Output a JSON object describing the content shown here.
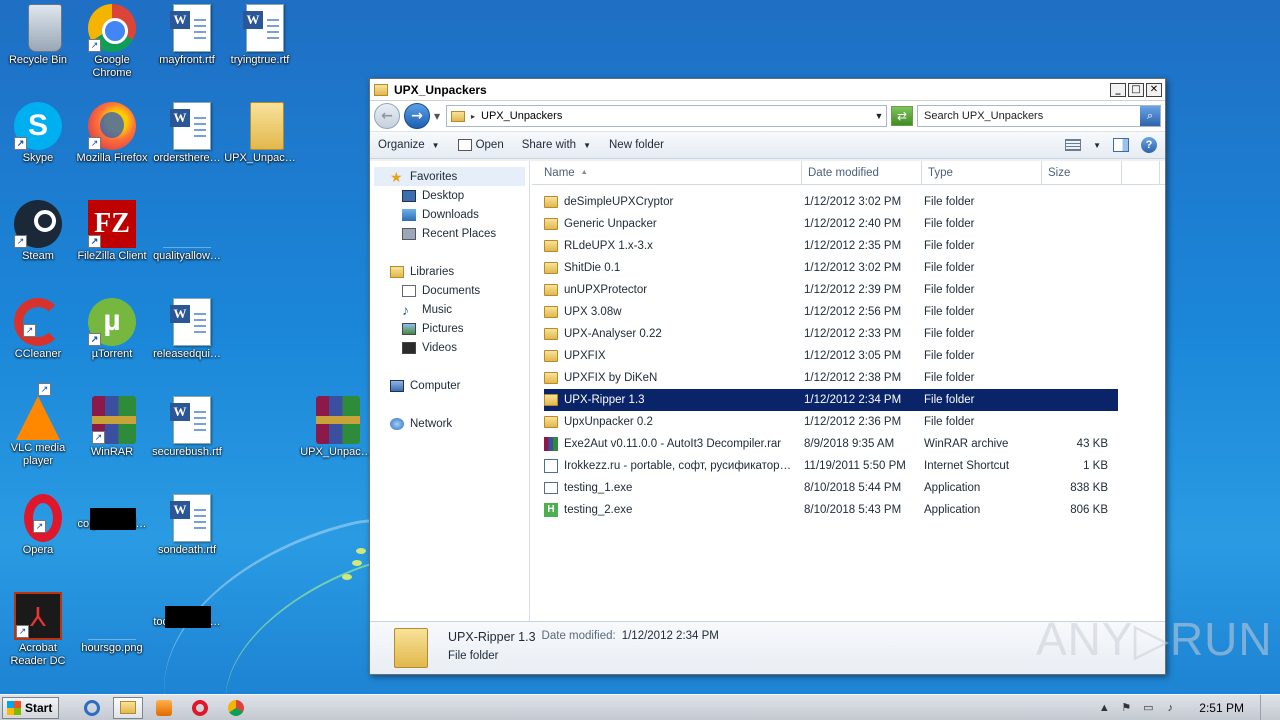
{
  "desktop": {
    "icons": [
      {
        "label": "Recycle Bin",
        "icon": "recycle-bin-icon"
      },
      {
        "label": "Google Chrome",
        "icon": "chrome-icon"
      },
      {
        "label": "mayfront.rtf",
        "icon": "word-document-icon"
      },
      {
        "label": "tryingtrue.rtf",
        "icon": "word-document-icon"
      },
      {
        "label": "Skype",
        "icon": "skype-icon"
      },
      {
        "label": "Mozilla Firefox",
        "icon": "firefox-icon"
      },
      {
        "label": "ordersthere…",
        "icon": "word-document-icon"
      },
      {
        "label": "UPX_Unpac…",
        "icon": "folder-icon"
      },
      {
        "label": "Steam",
        "icon": "steam-icon"
      },
      {
        "label": "FileZilla Client",
        "icon": "filezilla-icon"
      },
      {
        "label": "qualityallow…",
        "icon": "blank-file-icon"
      },
      {
        "label": "CCleaner",
        "icon": "ccleaner-icon"
      },
      {
        "label": "µTorrent",
        "icon": "utorrent-icon"
      },
      {
        "label": "releasedqui…",
        "icon": "word-document-icon"
      },
      {
        "label": "VLC media player",
        "icon": "vlc-icon"
      },
      {
        "label": "WinRAR",
        "icon": "winrar-icon"
      },
      {
        "label": "securebush.rtf",
        "icon": "word-document-icon"
      },
      {
        "label": "UPX_Unpac…",
        "icon": "winrar-archive-icon"
      },
      {
        "label": "Opera",
        "icon": "opera-icon"
      },
      {
        "label": "corporationf…",
        "icon": "black-thumbnail-icon"
      },
      {
        "label": "sondeath.rtf",
        "icon": "word-document-icon"
      },
      {
        "label": "Acrobat Reader DC",
        "icon": "acrobat-icon"
      },
      {
        "label": "hoursgo.png",
        "icon": "blank-image-icon"
      },
      {
        "label": "tocertificate…",
        "icon": "black-thumbnail-icon"
      }
    ]
  },
  "window": {
    "title": "UPX_Unpackers",
    "controls": {
      "minimize": "_",
      "maximize": "□",
      "close": "✕"
    },
    "address": {
      "path": "UPX_Unpackers"
    },
    "search": {
      "placeholder": "Search UPX_Unpackers"
    },
    "commands": {
      "organize": "Organize",
      "open": "Open",
      "share_with": "Share with",
      "new_folder": "New folder"
    },
    "nav": {
      "favorites": "Favorites",
      "desktop": "Desktop",
      "downloads": "Downloads",
      "recent_places": "Recent Places",
      "libraries": "Libraries",
      "documents": "Documents",
      "music": "Music",
      "pictures": "Pictures",
      "videos": "Videos",
      "computer": "Computer",
      "network": "Network"
    },
    "columns": {
      "name": "Name",
      "date": "Date modified",
      "type": "Type",
      "size": "Size"
    },
    "files": [
      {
        "name": "deSimpleUPXCryptor",
        "date": "1/12/2012 3:02 PM",
        "type": "File folder",
        "size": "",
        "icon": "folder-icon"
      },
      {
        "name": "Generic Unpacker",
        "date": "1/12/2012 2:40 PM",
        "type": "File folder",
        "size": "",
        "icon": "folder-icon"
      },
      {
        "name": "RLdeUPX 1.x-3.x",
        "date": "1/12/2012 2:35 PM",
        "type": "File folder",
        "size": "",
        "icon": "folder-icon"
      },
      {
        "name": "ShitDie 0.1",
        "date": "1/12/2012 3:02 PM",
        "type": "File folder",
        "size": "",
        "icon": "folder-icon"
      },
      {
        "name": "unUPXProtector",
        "date": "1/12/2012 2:39 PM",
        "type": "File folder",
        "size": "",
        "icon": "folder-icon"
      },
      {
        "name": "UPX 3.08w",
        "date": "1/12/2012 2:56 PM",
        "type": "File folder",
        "size": "",
        "icon": "folder-icon"
      },
      {
        "name": "UPX-Analyser 0.22",
        "date": "1/12/2012 2:33 PM",
        "type": "File folder",
        "size": "",
        "icon": "folder-icon"
      },
      {
        "name": "UPXFIX",
        "date": "1/12/2012 3:05 PM",
        "type": "File folder",
        "size": "",
        "icon": "folder-icon"
      },
      {
        "name": "UPXFIX by DiKeN",
        "date": "1/12/2012 2:38 PM",
        "type": "File folder",
        "size": "",
        "icon": "folder-icon"
      },
      {
        "name": "UPX-Ripper 1.3",
        "date": "1/12/2012 2:34 PM",
        "type": "File folder",
        "size": "",
        "icon": "folder-icon",
        "selected": true
      },
      {
        "name": "UpxUnpacker 0.2",
        "date": "1/12/2012 2:36 PM",
        "type": "File folder",
        "size": "",
        "icon": "folder-icon"
      },
      {
        "name": "Exe2Aut v0.11.0.0 - AutoIt3 Decompiler.rar",
        "date": "8/9/2018 9:35 AM",
        "type": "WinRAR archive",
        "size": "43 KB",
        "icon": "winrar-archive-icon"
      },
      {
        "name": "Irokkezz.ru - portable, софт, русификатор…",
        "date": "11/19/2011 5:50 PM",
        "type": "Internet Shortcut",
        "size": "1 KB",
        "icon": "internet-shortcut-icon"
      },
      {
        "name": "testing_1.exe",
        "date": "8/10/2018 5:44 PM",
        "type": "Application",
        "size": "838 KB",
        "icon": "application-icon"
      },
      {
        "name": "testing_2.exe",
        "date": "8/10/2018 5:43 PM",
        "type": "Application",
        "size": "806 KB",
        "icon": "h-application-icon"
      }
    ],
    "details": {
      "name": "UPX-Ripper 1.3",
      "date_label": "Date modified:",
      "date_value": "1/12/2012 2:34 PM",
      "type": "File folder"
    }
  },
  "watermark": "ANY▷RUN",
  "taskbar": {
    "start": "Start",
    "clock": "2:51 PM",
    "apps": [
      "internet-explorer-icon",
      "explorer-icon",
      "media-player-icon",
      "opera-icon",
      "chrome-icon"
    ]
  },
  "colors": {
    "selection": "#0a246a",
    "desktop": "#1b86d8"
  }
}
